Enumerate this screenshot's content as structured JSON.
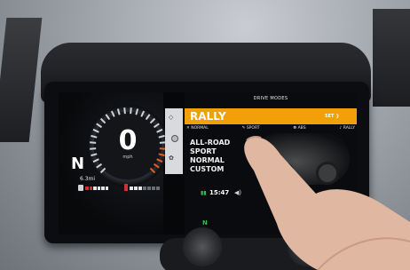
{
  "screen": {
    "title": "DRIVE MODES",
    "selected_mode": "RALLY",
    "set_label": "SET ❯",
    "sub_modes": [
      "✕ NORMAL",
      "✎ SPORT",
      "❁ ABS",
      "♪ RALLY"
    ],
    "modes": [
      "ALL-ROAD",
      "SPORT",
      "NORMAL",
      "CUSTOM"
    ],
    "clock": "15:47",
    "accent_color": "#f2a007",
    "indicator_color": "#2fbf4a"
  },
  "cluster": {
    "speed": "0",
    "speed_unit": "mph",
    "gear": "N",
    "odometer": "6.3mi",
    "neutral_indicator": "N"
  }
}
